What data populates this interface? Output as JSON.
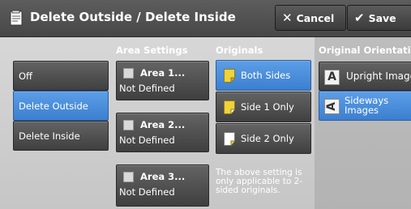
{
  "header": {
    "title": "Delete Outside / Delete Inside",
    "cancel_label": "Cancel",
    "save_label": "Save"
  },
  "columns": {
    "area_settings": "Area Settings",
    "originals": "Originals",
    "orientation": "Original Orientation"
  },
  "mode": {
    "options": [
      "Off",
      "Delete Outside",
      "Delete Inside"
    ],
    "selected": "Delete Outside"
  },
  "areas": [
    {
      "name": "Area 1...",
      "status": "Not Defined"
    },
    {
      "name": "Area 2...",
      "status": "Not Defined"
    },
    {
      "name": "Area 3...",
      "status": "Not Defined"
    }
  ],
  "originals": {
    "options": [
      "Both Sides",
      "Side 1 Only",
      "Side 2 Only"
    ],
    "selected": "Both Sides",
    "note": "The above setting is only applicable to 2-sided originals."
  },
  "orientation": {
    "options": [
      "Upright Images",
      "Sideways Images"
    ],
    "selected": "Sideways Images"
  },
  "colors": {
    "selected_blue": "#4a8fdc",
    "page_yellow": "#f0d23a",
    "header_gray": "#4f4f4f"
  },
  "icons": [
    "document-icon",
    "x-icon",
    "check-icon",
    "checkbox-icon",
    "page-icon",
    "upright-A-icon",
    "sideways-A-icon"
  ]
}
